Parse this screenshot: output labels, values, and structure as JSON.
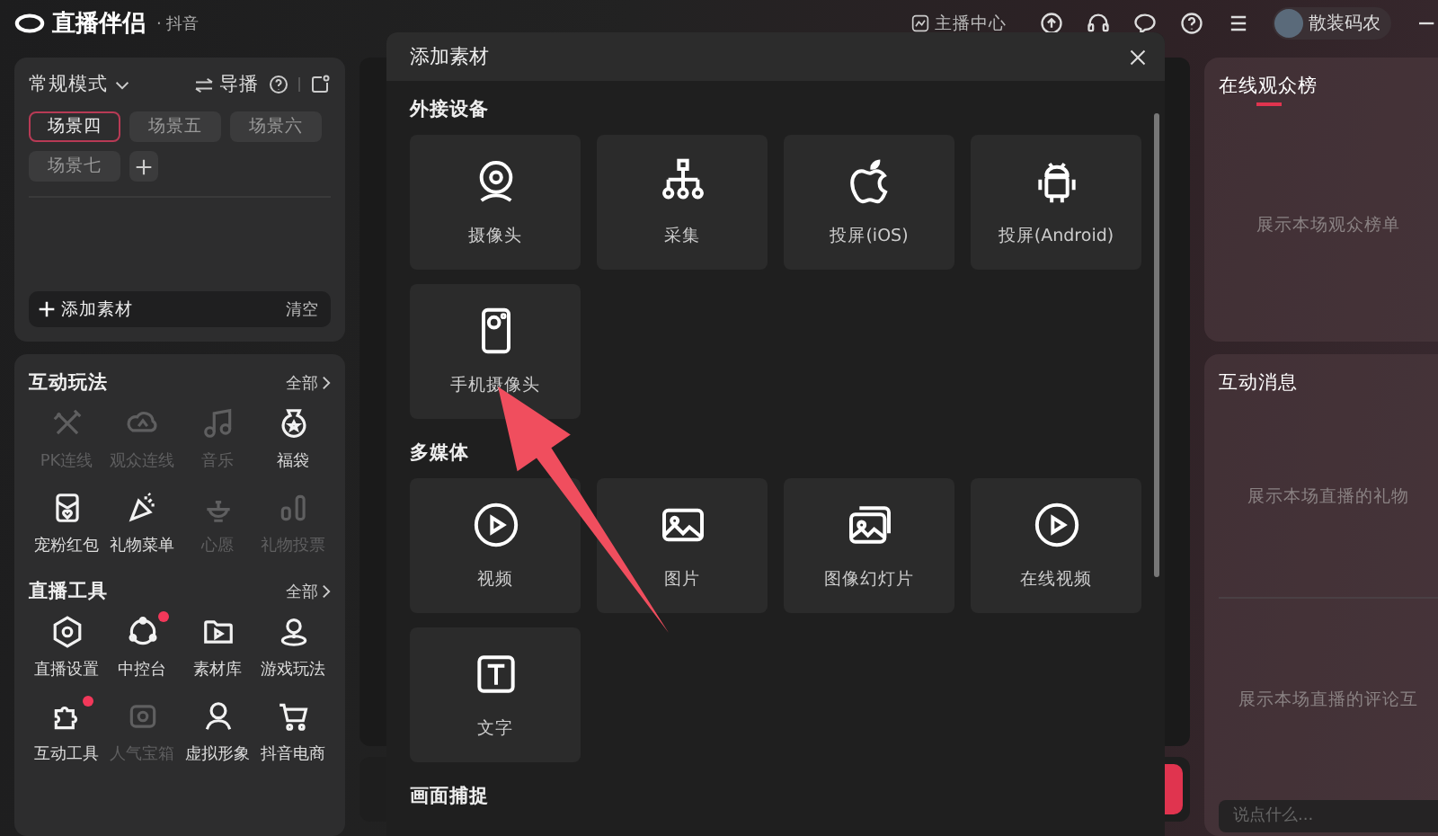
{
  "app": {
    "title": "直播伴侣",
    "platform": "· 抖音"
  },
  "topbar": {
    "creator_center": "主播中心",
    "user": "散装码农"
  },
  "scenes_panel": {
    "mode": "常规模式",
    "director": "导播",
    "scenes": [
      {
        "label": "场景四",
        "selected": true
      },
      {
        "label": "场景五",
        "selected": false
      },
      {
        "label": "场景六",
        "selected": false
      },
      {
        "label": "场景七",
        "selected": false
      }
    ],
    "add_material": "添加素材",
    "clear": "清空"
  },
  "interaction": {
    "title": "互动玩法",
    "more": "全部",
    "items": [
      {
        "label": "PK连线",
        "kind": "pk",
        "disabled": true,
        "badge": false
      },
      {
        "label": "观众连线",
        "kind": "link",
        "disabled": true,
        "badge": false
      },
      {
        "label": "音乐",
        "kind": "music",
        "disabled": true,
        "badge": false
      },
      {
        "label": "福袋",
        "kind": "bag",
        "disabled": false,
        "badge": false
      },
      {
        "label": "宠粉红包",
        "kind": "envelope",
        "disabled": false,
        "badge": false
      },
      {
        "label": "礼物菜单",
        "kind": "popper",
        "disabled": false,
        "badge": false
      },
      {
        "label": "心愿",
        "kind": "lamp",
        "disabled": true,
        "badge": false
      },
      {
        "label": "礼物投票",
        "kind": "vote",
        "disabled": true,
        "badge": false
      }
    ]
  },
  "tools": {
    "title": "直播工具",
    "more": "全部",
    "items": [
      {
        "label": "直播设置",
        "kind": "settings",
        "disabled": false,
        "badge": false
      },
      {
        "label": "中控台",
        "kind": "orbit",
        "disabled": false,
        "badge": true
      },
      {
        "label": "素材库",
        "kind": "folder",
        "disabled": false,
        "badge": false
      },
      {
        "label": "游戏玩法",
        "kind": "pin",
        "disabled": false,
        "badge": false
      },
      {
        "label": "互动工具",
        "kind": "puzzle",
        "disabled": false,
        "badge": true
      },
      {
        "label": "人气宝箱",
        "kind": "box",
        "disabled": true,
        "badge": false
      },
      {
        "label": "虚拟形象",
        "kind": "person",
        "disabled": false,
        "badge": false
      },
      {
        "label": "抖音电商",
        "kind": "cart",
        "disabled": false,
        "badge": false
      }
    ]
  },
  "modal": {
    "title": "添加素材",
    "sections": [
      {
        "title": "外接设备",
        "tiles": [
          {
            "label": "摄像头",
            "kind": "webcam"
          },
          {
            "label": "采集",
            "kind": "network"
          },
          {
            "label": "投屏(iOS)",
            "kind": "apple"
          },
          {
            "label": "投屏(Android)",
            "kind": "android"
          },
          {
            "label": "手机摄像头",
            "kind": "phonecam"
          }
        ]
      },
      {
        "title": "多媒体",
        "tiles": [
          {
            "label": "视频",
            "kind": "play"
          },
          {
            "label": "图片",
            "kind": "image"
          },
          {
            "label": "图像幻灯片",
            "kind": "slides"
          },
          {
            "label": "在线视频",
            "kind": "play"
          },
          {
            "label": "文字",
            "kind": "text"
          }
        ]
      },
      {
        "title": "画面捕捉"
      }
    ]
  },
  "audience": {
    "tab": "在线观众榜",
    "empty": "展示本场观众榜单"
  },
  "messages": {
    "title": "互动消息",
    "gift_empty": "展示本场直播的礼物",
    "comment_empty": "展示本场直播的评论互",
    "input": {
      "placeholder": "说点什么..."
    }
  }
}
